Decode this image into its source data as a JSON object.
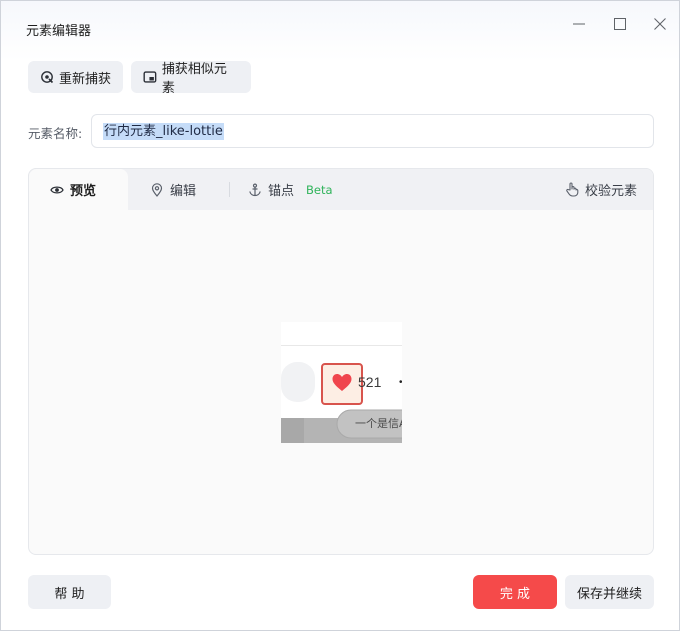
{
  "window": {
    "title": "元素编辑器"
  },
  "toolbar": {
    "recapture_label": "重新捕获",
    "capture_similar_label": "捕获相似元素"
  },
  "element_name": {
    "label": "元素名称:",
    "value": "行内元素_like-lottie"
  },
  "tabs": [
    {
      "label": "预览",
      "icon": "eye-icon",
      "active": true
    },
    {
      "label": "编辑",
      "icon": "location-pin-icon",
      "active": false
    },
    {
      "label": "锚点",
      "icon": "anchor-icon",
      "active": false,
      "badge": "Beta"
    }
  ],
  "verify": {
    "label": "校验元素",
    "icon": "pointing-hand-icon"
  },
  "preview": {
    "like_count": "521",
    "caption_fragment": "一个是信A"
  },
  "footer": {
    "help_label": "帮 助",
    "done_label": "完 成",
    "save_continue_label": "保存并继续"
  },
  "colors": {
    "primary": "#f54a4a",
    "beta_green": "#2fb35a",
    "selection": "#c5dcf8",
    "heart": "#f0454d"
  }
}
